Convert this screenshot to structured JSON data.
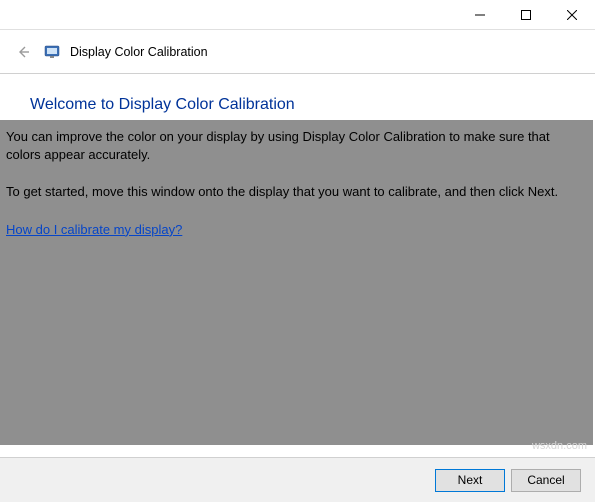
{
  "window": {
    "minimize": "—",
    "maximize": "☐",
    "close": "✕"
  },
  "header": {
    "back": "←",
    "title": "Display Color Calibration"
  },
  "page": {
    "heading": "Welcome to Display Color Calibration",
    "paragraph1": "You can improve the color on your display by using Display Color Calibration to make sure that colors appear accurately.",
    "paragraph2": "To get started, move this window onto the display that you want to calibrate, and then click Next.",
    "help_link": "How do I calibrate my display?"
  },
  "footer": {
    "next": "Next",
    "cancel": "Cancel"
  },
  "watermark": "wsxdn.com"
}
